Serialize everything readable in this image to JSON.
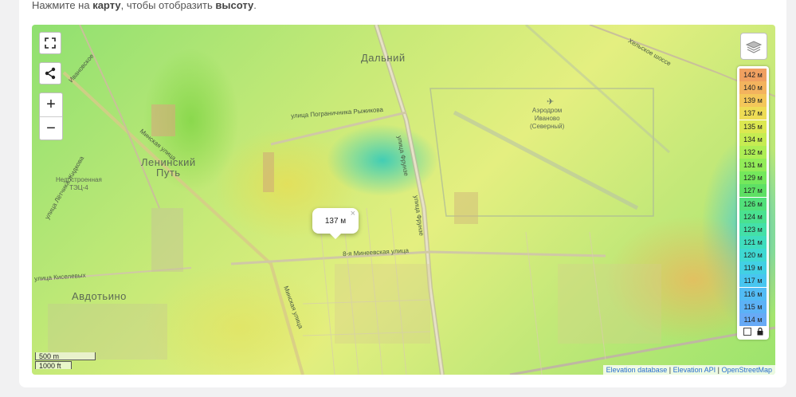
{
  "hint": {
    "prefix": "Нажмите на ",
    "map_word": "карту",
    "middle": ", чтобы отобразить ",
    "height_word": "высоту",
    "suffix": "."
  },
  "map": {
    "places": [
      {
        "name": "Дальний",
        "id": "dalniy"
      },
      {
        "name": "Ленинский\nПуть",
        "id": "leninsky-put"
      },
      {
        "name": "Авдотьино",
        "id": "avdotino"
      },
      {
        "name": "Недостроенная\nТЭЦ-4",
        "id": "tec4"
      },
      {
        "name": "Аэродром\nИваново\n(Северный)",
        "id": "airport"
      }
    ],
    "streets": [
      {
        "name": "улица Пограничника Рыжикова",
        "id": "pogranichnika"
      },
      {
        "name": "Минская улица",
        "id": "minskaya-1"
      },
      {
        "name": "Минская улица",
        "id": "minskaya-2"
      },
      {
        "name": "8-я Минеевская улица",
        "id": "mineevskaya"
      },
      {
        "name": "улица Фрунзе",
        "id": "frunze-1"
      },
      {
        "name": "улица Фрунзе",
        "id": "frunze-2"
      },
      {
        "name": "улица Киселевых",
        "id": "kiselevykh"
      },
      {
        "name": "улица Лётчика Жидкова",
        "id": "zhidkova"
      },
      {
        "name": "Ивановское",
        "id": "ivanovskoe"
      },
      {
        "name": "Хельское шоссе",
        "id": "shosse"
      }
    ],
    "popup": {
      "value": "137 м",
      "close": "×"
    },
    "controls": {
      "fullscreen": "⛶",
      "share": "share",
      "zoom_in": "+",
      "zoom_out": "−"
    },
    "scale": {
      "metric": "500 m",
      "imperial": "1000 ft"
    },
    "attribution": {
      "db": "Elevation database",
      "api": "Elevation API",
      "osm": "OpenStreetMap",
      "sep": " | "
    }
  },
  "legend": {
    "items": [
      {
        "label": "142 м",
        "color": "#f0a060"
      },
      {
        "label": "140 м",
        "color": "#f3b35e"
      },
      {
        "label": "139 м",
        "color": "#f4c75a"
      },
      {
        "label": "137 м",
        "color": "#eedc55"
      },
      {
        "label": "135 м",
        "color": "#dce851"
      },
      {
        "label": "134 м",
        "color": "#c6ec52"
      },
      {
        "label": "132 м",
        "color": "#aeee55"
      },
      {
        "label": "131 м",
        "color": "#92ec58"
      },
      {
        "label": "129 м",
        "color": "#74e85c"
      },
      {
        "label": "127 м",
        "color": "#5ee064"
      },
      {
        "label": "126 м",
        "color": "#52e07a"
      },
      {
        "label": "124 м",
        "color": "#4ae190"
      },
      {
        "label": "123 м",
        "color": "#44e0a8"
      },
      {
        "label": "121 м",
        "color": "#40ddbe"
      },
      {
        "label": "120 м",
        "color": "#3fd8d2"
      },
      {
        "label": "119 м",
        "color": "#42d0e4"
      },
      {
        "label": "117 м",
        "color": "#48c6f0"
      },
      {
        "label": "116 м",
        "color": "#52bcf4"
      },
      {
        "label": "115 м",
        "color": "#5cb2f6"
      },
      {
        "label": "114 м",
        "color": "#68aaf6"
      }
    ]
  }
}
